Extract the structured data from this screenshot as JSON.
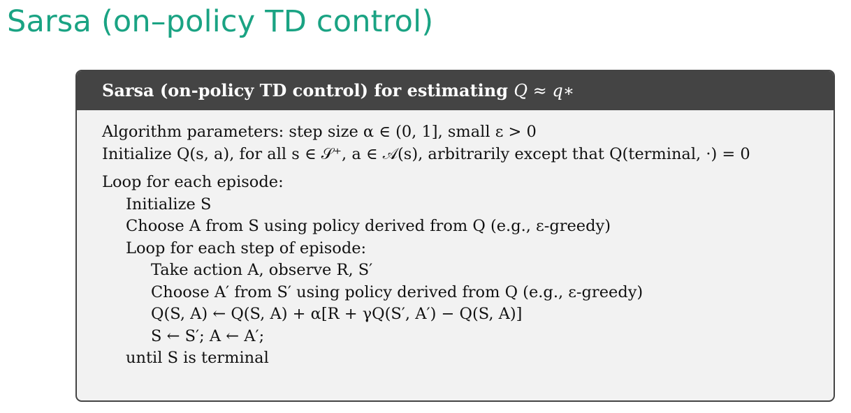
{
  "slide": {
    "title": "Sarsa (on–policy TD control)"
  },
  "algorithm": {
    "title_text": "Sarsa (on-policy TD control) for estimating ",
    "title_math": "Q ≈ q∗",
    "lines": [
      "Algorithm parameters: step size α ∈ (0, 1], small ε > 0",
      "Initialize Q(s, a), for all s ∈ 𝒮⁺, a ∈ 𝒜(s), arbitrarily except that Q(terminal, ·) = 0",
      "Loop for each episode:",
      "Initialize S",
      "Choose A from S using policy derived from Q (e.g., ε-greedy)",
      "Loop for each step of episode:",
      "Take action A, observe R, S′",
      "Choose A′ from S′ using policy derived from Q (e.g., ε-greedy)",
      "Q(S, A) ← Q(S, A) + α[R + γQ(S′, A′) − Q(S, A)]",
      "S ← S′; A ← A′;",
      "until S is terminal"
    ]
  }
}
